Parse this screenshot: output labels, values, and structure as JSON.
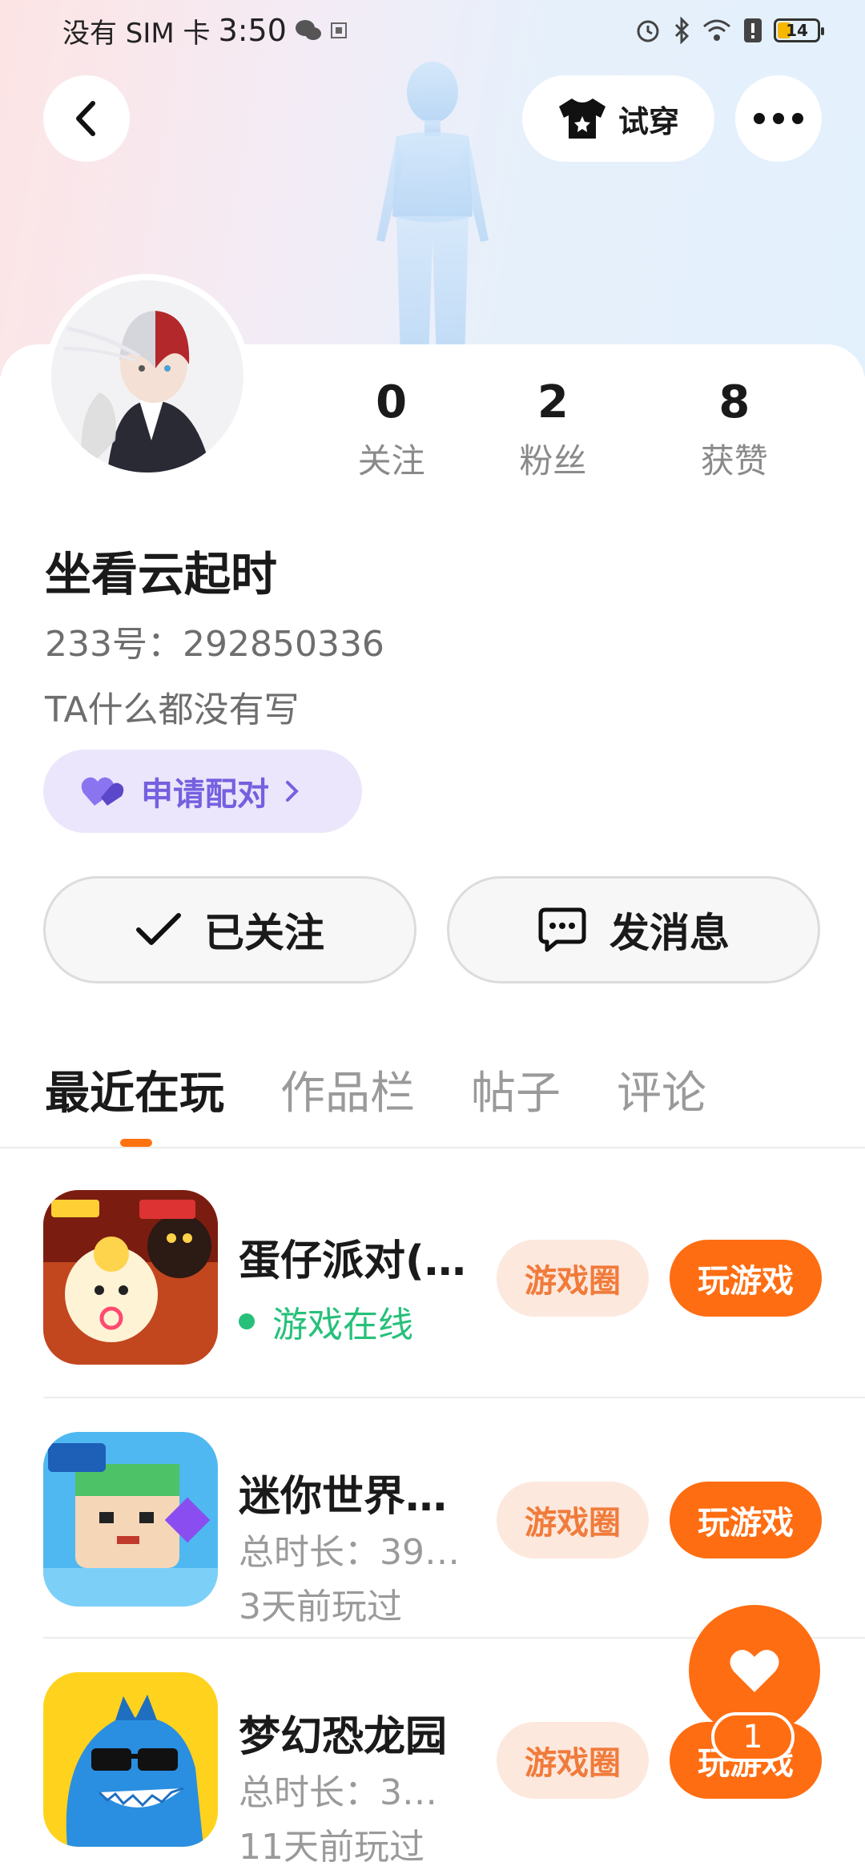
{
  "status_bar": {
    "carrier": "没有 SIM 卡",
    "time": "3:50",
    "battery": "14"
  },
  "header": {
    "try_on_label": "试穿"
  },
  "profile": {
    "stats": [
      {
        "value": "0",
        "label": "关注"
      },
      {
        "value": "2",
        "label": "粉丝"
      },
      {
        "value": "8",
        "label": "获赞"
      }
    ],
    "nickname": "坐看云起时",
    "uid": "233号：292850336",
    "bio": "TA什么都没有写",
    "pair_label": "申请配对",
    "follow_label": "已关注",
    "message_label": "发消息"
  },
  "tabs": [
    "最近在玩",
    "作品栏",
    "帖子",
    "评论"
  ],
  "games": [
    {
      "title": "蛋仔派对(…",
      "sub1": "游戏在线",
      "sub2": "",
      "online": true
    },
    {
      "title": "迷你世界…",
      "sub1": "总时长：39…",
      "sub2": "3天前玩过",
      "online": false
    },
    {
      "title": "梦幻恐龙园",
      "sub1": "总时长：3…",
      "sub2": "11天前玩过",
      "online": false
    }
  ],
  "game_buttons": {
    "circle": "游戏圈",
    "play": "玩游戏"
  },
  "fab": {
    "count": "1"
  },
  "colors": {
    "accent": "#ff6d12",
    "online": "#27c07a",
    "pair": "#7560e0"
  }
}
